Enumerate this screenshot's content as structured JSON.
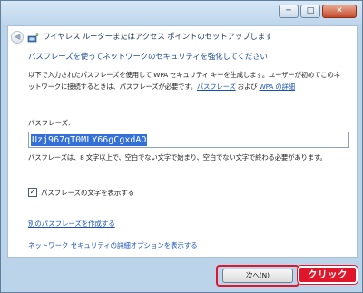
{
  "window": {
    "title": "ワイヤレス ルーターまたはアクセス ポイントのセットアップします",
    "controls": {
      "minimize": "─",
      "maximize": "□",
      "close": "✕"
    },
    "back_glyph": "◀"
  },
  "main": {
    "heading": "パスフレーズを使ってネットワークのセキュリティを強化してください",
    "description_text": "以下で入力されたパスフレーズを使用して WPA セキュリティ キーを生成します。ユーザーが初めてこのネットワークに接続するときは、パスフレーズが必要です。",
    "description_link1": "パスフレーズ",
    "description_and": " および ",
    "description_link2": "WPA の詳細",
    "passphrase_label": "パスフレーズ:",
    "passphrase_value": "Uzj967qT0MLY66gCgxdAO",
    "passphrase_hint": "パスフレーズは、8 文字以上で、空白でない文字で始まり、空白でない文字で終わる必要があります。",
    "show_characters_label": "パスフレーズの文字を表示する",
    "show_characters_checked": "✓",
    "link_create_other": "別のパスフレーズを作成する",
    "link_advanced_security": "ネットワーク セキュリティの詳細オプションを表示する"
  },
  "footer": {
    "next_button": "次へ(N)"
  },
  "annotation": {
    "callout": "クリック",
    "color": "#e0162b"
  }
}
